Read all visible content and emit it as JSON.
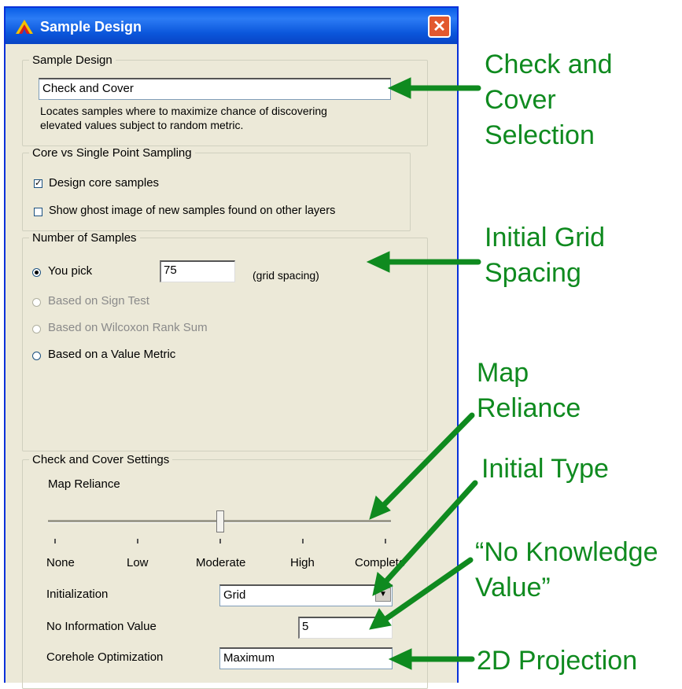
{
  "window": {
    "title": "Sample Design",
    "close_glyph": "✕"
  },
  "sample_design": {
    "legend": "Sample Design",
    "selected": "Check and Cover",
    "description_line1": "Locates samples where to maximize chance of discovering",
    "description_line2": "elevated values subject to random metric."
  },
  "core_group": {
    "legend": "Core vs Single Point Sampling",
    "design_core": {
      "label": "Design core samples",
      "checked": true
    },
    "ghost_image": {
      "label": "Show ghost image of new samples found on other layers",
      "checked": false
    }
  },
  "num_samples": {
    "legend": "Number of Samples",
    "you_pick": "You pick",
    "you_pick_value": "75",
    "grid_spacing": "(grid spacing)",
    "sign_test": "Based on Sign Test",
    "wilcoxon": "Based on Wilcoxon Rank Sum",
    "value_metric": "Based on a Value Metric"
  },
  "cc_settings": {
    "legend": "Check and Cover Settings",
    "map_reliance": "Map Reliance",
    "slider_level": 0.5,
    "ticks": [
      "None",
      "Low",
      "Moderate",
      "High",
      "Complete"
    ],
    "initialization_label": "Initialization",
    "initialization_value": "Grid",
    "no_info_label": "No Information Value",
    "no_info_value": "5",
    "corehole_label": "Corehole Optimization",
    "corehole_value": "Maximum"
  },
  "annotations": {
    "check_cover": [
      "Check and",
      "Cover",
      "Selection"
    ],
    "grid_spacing": [
      "Initial Grid",
      "Spacing"
    ],
    "map_reliance": [
      "Map",
      "Reliance"
    ],
    "initial_type": "Initial Type",
    "no_knowledge": [
      "“No Knowledge",
      "Value”"
    ],
    "projection": "2D Projection"
  },
  "colors": {
    "annotation": "#0f8a1f",
    "titlebar": "#0a5fe8",
    "close": "#e2582e"
  }
}
